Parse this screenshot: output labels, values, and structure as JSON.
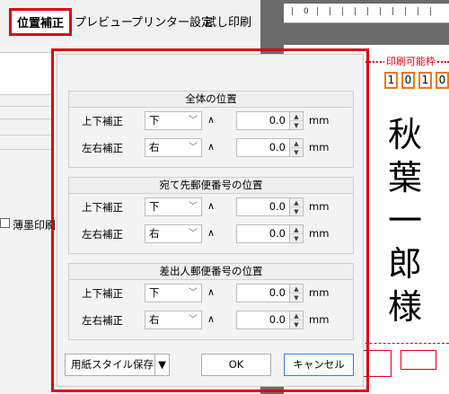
{
  "tabs": [
    {
      "label": "位置補正"
    },
    {
      "label": "プレビュー"
    },
    {
      "label": "プリンター設定"
    },
    {
      "label": "試し印刷"
    }
  ],
  "left_panel": {
    "checkbox_label": "薄墨印刷を"
  },
  "preview": {
    "printable_label": "印刷可能枠",
    "zip_digits": [
      "1",
      "0",
      "1",
      "0"
    ],
    "recipient_name": [
      "秋",
      "葉",
      "一",
      "郎",
      "様"
    ]
  },
  "dialog": {
    "sections": [
      {
        "title": "全体の位置",
        "rows": [
          {
            "label": "上下補正",
            "direction": "下",
            "caret": "∧",
            "value": "0.0",
            "unit": "mm"
          },
          {
            "label": "左右補正",
            "direction": "右",
            "caret": "∧",
            "value": "0.0",
            "unit": "mm"
          }
        ]
      },
      {
        "title": "宛て先郵便番号の位置",
        "rows": [
          {
            "label": "上下補正",
            "direction": "下",
            "caret": "∧",
            "value": "0.0",
            "unit": "mm"
          },
          {
            "label": "左右補正",
            "direction": "右",
            "caret": "∧",
            "value": "0.0",
            "unit": "mm"
          }
        ]
      },
      {
        "title": "差出人郵便番号の位置",
        "rows": [
          {
            "label": "上下補正",
            "direction": "下",
            "caret": "∧",
            "value": "0.0",
            "unit": "mm"
          },
          {
            "label": "左右補正",
            "direction": "右",
            "caret": "∧",
            "value": "0.0",
            "unit": "mm"
          }
        ]
      }
    ],
    "save_style_label": "用紙スタイル保存",
    "ok_label": "OK",
    "cancel_label": "キャンセル"
  },
  "colors": {
    "highlight": "#e00012",
    "zip_border": "#e97a19",
    "preview_bg": "#6b6b6b"
  }
}
